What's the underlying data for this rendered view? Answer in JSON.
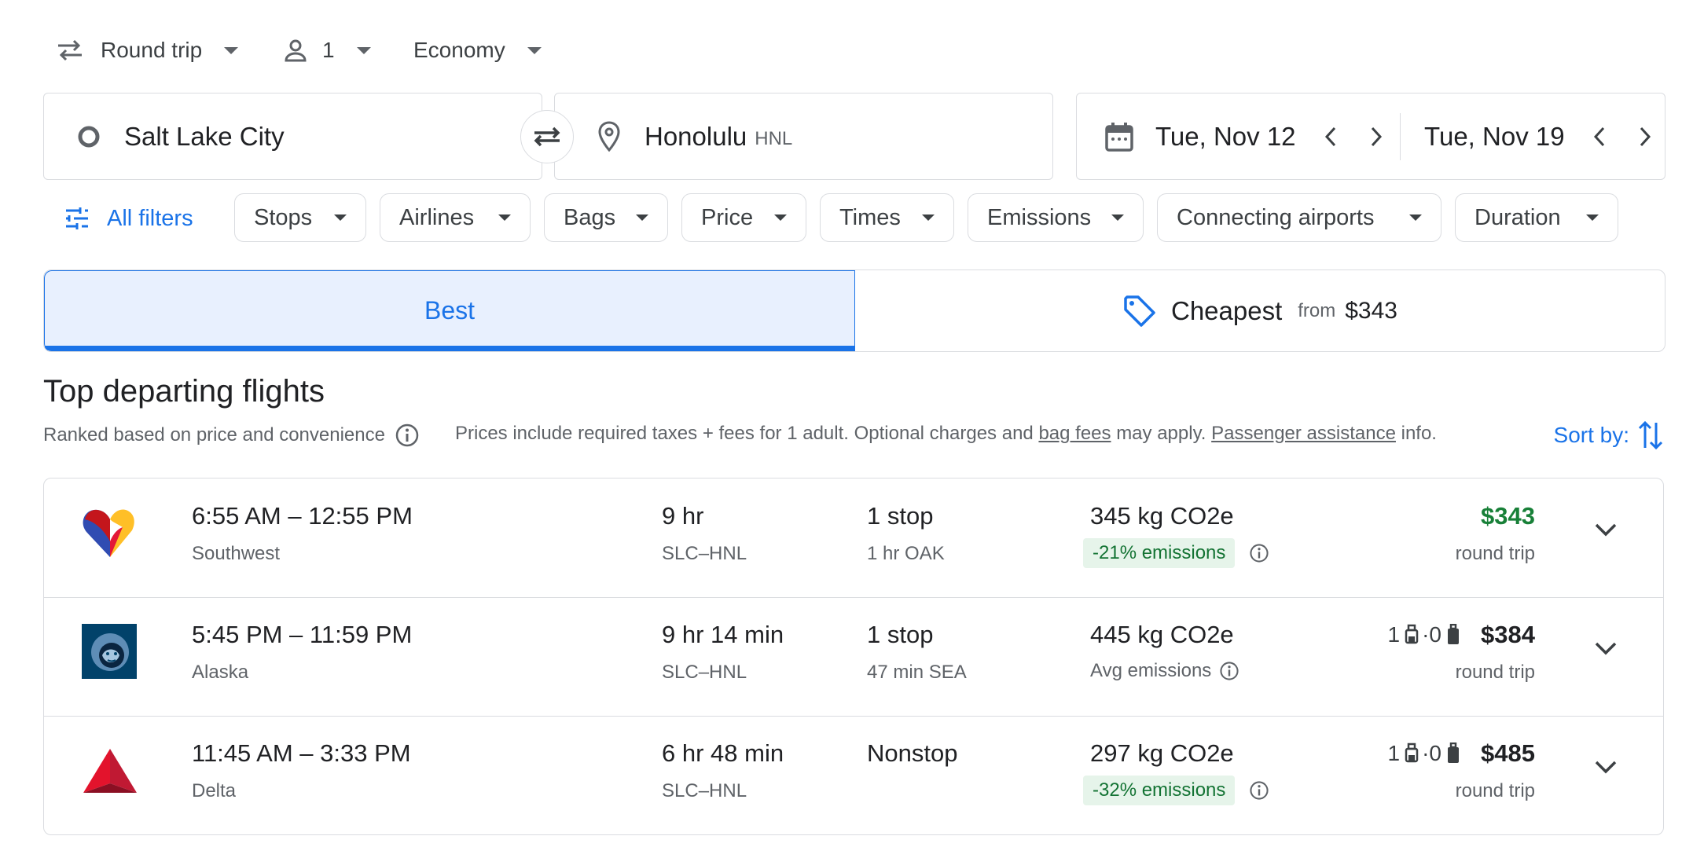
{
  "trip": {
    "type_label": "Round trip",
    "passengers": "1",
    "cabin": "Economy"
  },
  "search": {
    "origin": "Salt Lake City",
    "destination": "Honolulu",
    "destination_code": "HNL",
    "depart_date": "Tue, Nov 12",
    "return_date": "Tue, Nov 19"
  },
  "filters": {
    "all_filters": "All filters",
    "chips": [
      "Stops",
      "Airlines",
      "Bags",
      "Price",
      "Times",
      "Emissions",
      "Connecting airports",
      "Duration"
    ]
  },
  "tabs": {
    "best": "Best",
    "cheapest": "Cheapest",
    "cheapest_from": "from",
    "cheapest_price": "$343"
  },
  "results_header": {
    "title": "Top departing flights",
    "ranked": "Ranked based on price and convenience",
    "prices_note_1": "Prices include required taxes + fees for 1 adult. Optional charges and",
    "bag_fees": "bag fees",
    "prices_note_2": "may apply.",
    "passenger_assistance": "Passenger assistance",
    "prices_note_3": "info.",
    "sort_by": "Sort by:"
  },
  "flights": [
    {
      "airline": "Southwest",
      "logo": "southwest-heart-logo",
      "times": "6:55 AM – 12:55 PM",
      "duration": "9 hr",
      "route": "SLC–HNL",
      "stops": "1 stop",
      "layover": "1 hr OAK",
      "co2": "345 kg CO2e",
      "emissions": "-21% emissions",
      "emissions_type": "lower",
      "bags_carry": "",
      "bags_checked": "",
      "price": "$343",
      "price_note": "round trip",
      "price_color": "#188038"
    },
    {
      "airline": "Alaska",
      "logo": "alaska-eskimo-logo",
      "times": "5:45 PM – 11:59 PM",
      "duration": "9 hr 14 min",
      "route": "SLC–HNL",
      "stops": "1 stop",
      "layover": "47 min SEA",
      "co2": "445 kg CO2e",
      "emissions": "Avg emissions",
      "emissions_type": "avg",
      "bags_carry": "1",
      "bags_checked": "0",
      "price": "$384",
      "price_note": "round trip",
      "price_color": "#202124"
    },
    {
      "airline": "Delta",
      "logo": "delta-widget-logo",
      "times": "11:45 AM – 3:33 PM",
      "duration": "6 hr 48 min",
      "route": "SLC–HNL",
      "stops": "Nonstop",
      "layover": "",
      "co2": "297 kg CO2e",
      "emissions": "-32% emissions",
      "emissions_type": "lower",
      "bags_carry": "1",
      "bags_checked": "0",
      "price": "$485",
      "price_note": "round trip",
      "price_color": "#202124"
    }
  ],
  "colors": {
    "accent": "#1a73e8",
    "green": "#188038",
    "border": "#dadce0"
  }
}
